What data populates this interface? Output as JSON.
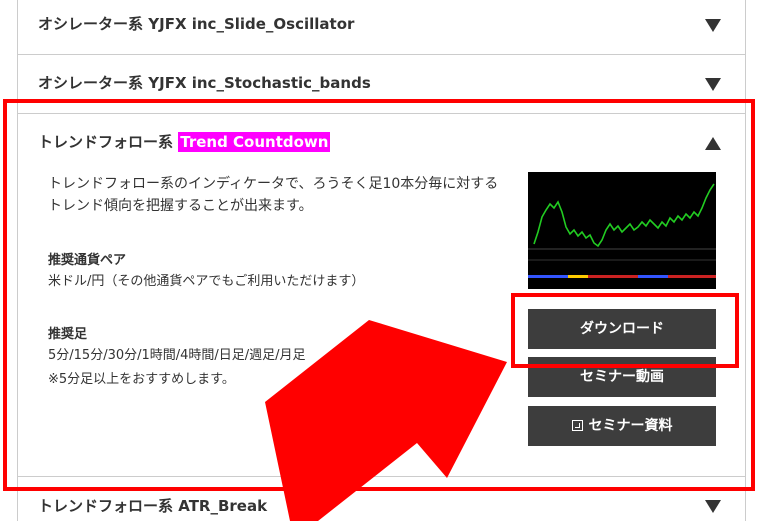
{
  "accordion": {
    "items": [
      {
        "category": "オシレーター系",
        "name": "YJFX inc_Slide_Oscillator",
        "state": "collapsed"
      },
      {
        "category": "オシレーター系",
        "name": "YJFX inc_Stochastic_bands",
        "state": "collapsed"
      },
      {
        "category": "トレンドフォロー系",
        "name": "Trend Countdown",
        "state": "expanded"
      },
      {
        "category": "トレンドフォロー系",
        "name": "ATR_Break",
        "state": "collapsed"
      }
    ]
  },
  "panel": {
    "description_line1": "トレンドフォロー系のインディケータで、ろうそく足10本分毎に対する",
    "description_line2": "トレンド傾向を把握することが出来ます。",
    "pair_heading": "推奨通貨ペア",
    "pair_text": "米ドル/円（その他通貨ペアでもご利用いただけます）",
    "timeframe_heading": "推奨足",
    "timeframe_text": "5分/15分/30分/1時間/4時間/日足/週足/月足",
    "timeframe_note": "※5分足以上をおすすめします。"
  },
  "buttons": {
    "download": "ダウンロード",
    "seminar_video": "セミナー動画",
    "seminar_docs": "セミナー資料"
  },
  "colors": {
    "highlight": "#ff00ff",
    "button_bg": "#3d3d3d",
    "annotation_red": "#ff0000",
    "chart_line": "#22cc22"
  }
}
